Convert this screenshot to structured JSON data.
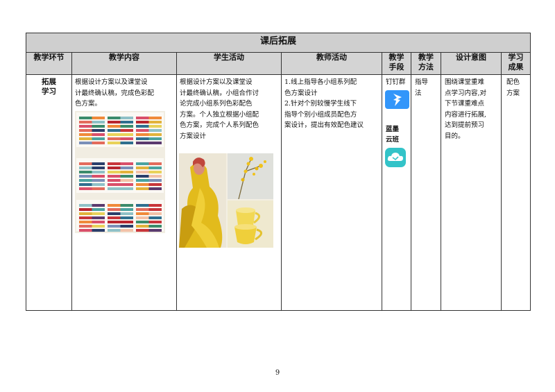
{
  "section_title": "课后拓展",
  "headers": {
    "stage": "教学环节",
    "content": "教学内容",
    "student": "学生活动",
    "teacher": "教师活动",
    "means": [
      "教学",
      "手段"
    ],
    "method": [
      "教学",
      "方法"
    ],
    "intent": "设计意图",
    "outcome": [
      "学习",
      "成果"
    ]
  },
  "row": {
    "stage": [
      "拓展",
      "学习"
    ],
    "content": [
      "根据设计方案以及课堂设",
      "计最终确认稿，完成色彩配",
      "色方案。"
    ],
    "student": [
      "根据设计方案以及课堂设",
      "计最终确认稿，小组合作讨",
      "论完成小组系列色彩配色",
      "方案。个人独立根据小组配",
      "色方案，完成个人系列配色",
      "方案设计"
    ],
    "teacher": [
      "1.线上指导各小组系列配",
      "色方案设计",
      "2.针对个别较慢学生线下",
      "指导个别小组成员配色方",
      "案设计，提出有效配色建议"
    ],
    "means": {
      "tool1": "钉钉群",
      "tool2_lines": [
        "蓝墨",
        "云班"
      ],
      "tool1_icon": "dingtalk-icon",
      "tool2_icon": "mosoteach-cloud-icon"
    },
    "method": [
      "指导",
      "法"
    ],
    "intent": [
      "围绕课堂重难",
      "点学习内容,对",
      "下节课重难点",
      "内容进行拓展,",
      "达到提前预习",
      "目的。"
    ],
    "outcome": [
      "配色",
      "方案"
    ]
  },
  "page_number": "9",
  "colors": {
    "header_bg": "#d4d4d4",
    "title_bg": "#cfcfcf",
    "border": "#333333",
    "dingtalk_blue": "#3296fa",
    "mosoteach_teal": "#33c3c8"
  }
}
